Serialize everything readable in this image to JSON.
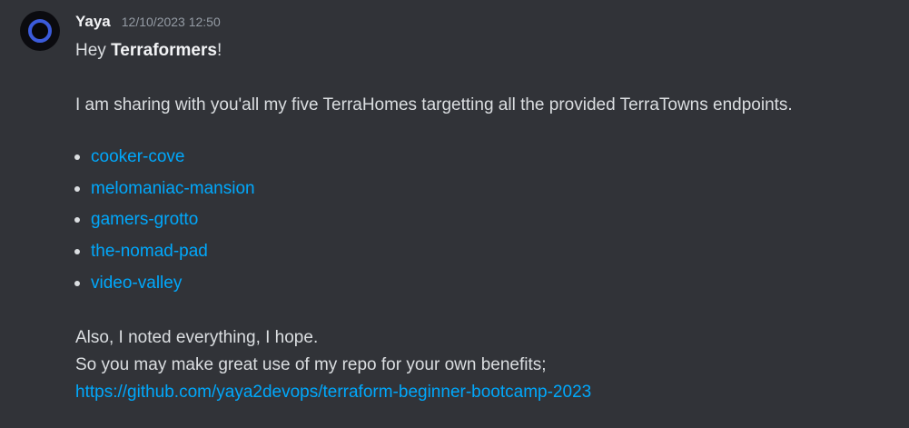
{
  "message": {
    "author": "Yaya",
    "timestamp": "12/10/2023 12:50",
    "greeting_prefix": "Hey ",
    "greeting_bold": "Terraformers",
    "greeting_suffix": "!",
    "intro": "I am sharing with you'all my five TerraHomes targetting all the provided TerraTowns endpoints.",
    "links": [
      "cooker-cove",
      "melomaniac-mansion",
      "gamers-grotto",
      "the-nomad-pad",
      "video-valley"
    ],
    "outro_line1": "Also, I noted everything, I hope.",
    "outro_line2": "So you may make great use of my repo for your own benefits;",
    "repo_url": "https://github.com/yaya2devops/terraform-beginner-bootcamp-2023"
  },
  "colors": {
    "background": "#313338",
    "text": "#dbdee1",
    "link": "#00a8fc",
    "timestamp": "#949ba4",
    "avatar_ring": "#3b5bdb"
  },
  "icons": {
    "avatar": "user-avatar-icon"
  }
}
